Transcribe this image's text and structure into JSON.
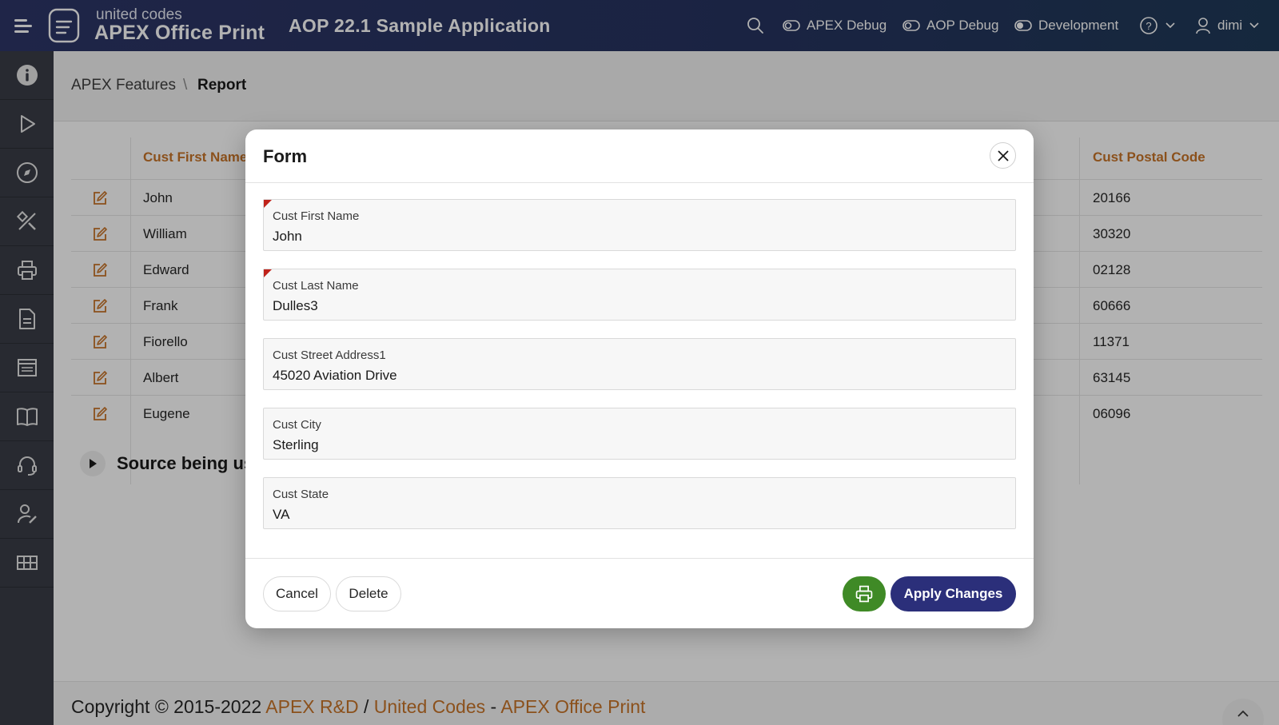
{
  "header": {
    "brand_top": "united codes",
    "brand_main": "APEX Office Print",
    "app_title": "AOP 22.1 Sample Application",
    "nav": {
      "apex_debug": "APEX Debug",
      "aop_debug": "AOP Debug",
      "development": "Development",
      "user": "dimi"
    }
  },
  "sidebar": {
    "items": [
      {
        "icon": "info-icon"
      },
      {
        "icon": "play-icon"
      },
      {
        "icon": "compass-icon"
      },
      {
        "icon": "tools-icon"
      },
      {
        "icon": "printer-icon"
      },
      {
        "icon": "document-icon"
      },
      {
        "icon": "report-icon"
      },
      {
        "icon": "book-icon"
      },
      {
        "icon": "headset-icon"
      },
      {
        "icon": "user-settings-icon"
      },
      {
        "icon": "grid-icon"
      }
    ]
  },
  "breadcrumb": {
    "parent": "APEX Features",
    "separator": "\\",
    "current": "Report"
  },
  "report": {
    "columns": {
      "first_name": "Cust First Name",
      "postal_code": "Cust Postal Code"
    },
    "rows": [
      {
        "first_name": "John",
        "postal_code": "20166"
      },
      {
        "first_name": "William",
        "postal_code": "30320"
      },
      {
        "first_name": "Edward",
        "postal_code": "02128"
      },
      {
        "first_name": "Frank",
        "postal_code": "60666"
      },
      {
        "first_name": "Fiorello",
        "postal_code": "11371"
      },
      {
        "first_name": "Albert",
        "postal_code": "63145"
      },
      {
        "first_name": "Eugene",
        "postal_code": "06096"
      }
    ]
  },
  "source_region": {
    "title": "Source being us"
  },
  "footer": {
    "prefix": "Copyright © 2015-2022 ",
    "link1": "APEX R&D",
    "sep1": " / ",
    "link2": "United Codes",
    "sep2": " - ",
    "link3": "APEX Office Print"
  },
  "modal": {
    "title": "Form",
    "fields": [
      {
        "label": "Cust First Name",
        "value": "John",
        "required": true
      },
      {
        "label": "Cust Last Name",
        "value": "Dulles3",
        "required": true
      },
      {
        "label": "Cust Street Address1",
        "value": "45020 Aviation Drive",
        "required": false
      },
      {
        "label": "Cust City",
        "value": "Sterling",
        "required": false
      },
      {
        "label": "Cust State",
        "value": "VA",
        "required": false
      }
    ],
    "buttons": {
      "cancel": "Cancel",
      "delete": "Delete",
      "apply": "Apply Changes"
    }
  },
  "colors": {
    "accent_orange": "#c87429",
    "header_navy": "#2d3567",
    "apply_button": "#2b2f7a",
    "print_button": "#3f8a26",
    "required_marker": "#c0231b"
  }
}
